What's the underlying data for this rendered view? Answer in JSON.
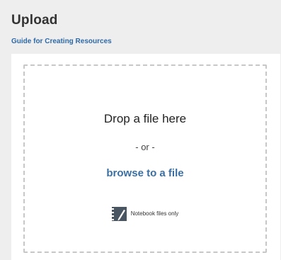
{
  "header": {
    "title": "Upload",
    "guide_link": "Guide for Creating Resources"
  },
  "dropzone": {
    "title": "Drop a file here",
    "or_text": "- or -",
    "browse_label": "browse to a file",
    "hint_icon": "notebook-icon",
    "hint_text": "Notebook files only"
  },
  "colors": {
    "background": "#eeeeee",
    "card": "#ffffff",
    "link": "#2e6aa8",
    "browse": "#3b6fa3",
    "dash_border": "#c7c7c7"
  }
}
